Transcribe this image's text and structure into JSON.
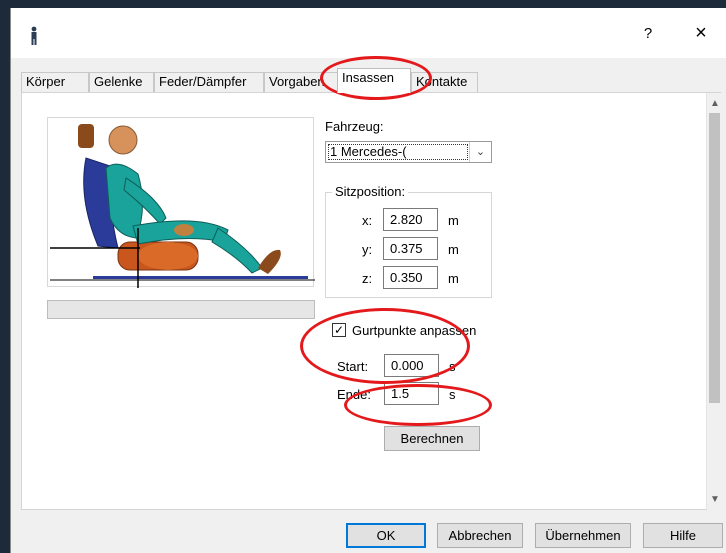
{
  "titlebar": {
    "help": "?",
    "close": "×"
  },
  "tabs": [
    "Körper",
    "Gelenke",
    "Feder/Dämpfer",
    "Vorgaben",
    "Insassen",
    "Kontakte"
  ],
  "fahrzeug": {
    "label": "Fahrzeug:",
    "value": "1 Mercedes-("
  },
  "sitzposition": {
    "title": "Sitzposition:",
    "rows": [
      {
        "axis": "x:",
        "value": "2.820",
        "unit": "m"
      },
      {
        "axis": "y:",
        "value": "0.375",
        "unit": "m"
      },
      {
        "axis": "z:",
        "value": "0.350",
        "unit": "m"
      }
    ]
  },
  "gurtpunkte": {
    "checked": true,
    "label": "Gurtpunkte anpassen"
  },
  "time": {
    "start": {
      "label": "Start:",
      "value": "0.000",
      "unit": "s"
    },
    "ende": {
      "label": "Ende:",
      "value": "1.5",
      "unit": "s"
    }
  },
  "buttons": {
    "berechnen": "Berechnen",
    "ok": "OK",
    "abbrechen": "Abbrechen",
    "uebernehmen": "Übernehmen",
    "hilfe": "Hilfe"
  },
  "colors": {
    "accent": "#0078d7",
    "annotation": "#e3191c"
  },
  "icons": {
    "app": "person-icon",
    "checkbox": "check-icon"
  }
}
